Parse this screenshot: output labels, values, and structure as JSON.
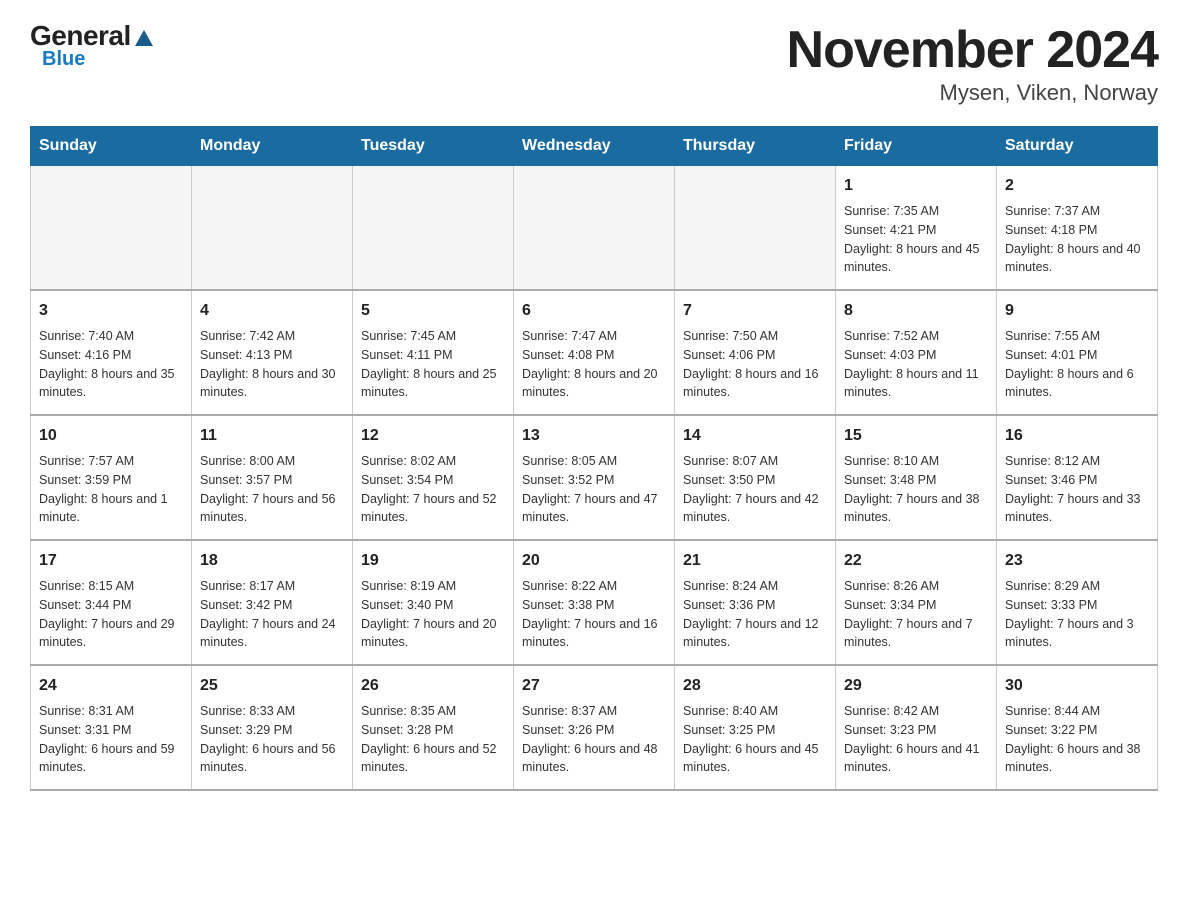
{
  "header": {
    "logo_general": "General",
    "logo_blue": "Blue",
    "title": "November 2024",
    "subtitle": "Mysen, Viken, Norway"
  },
  "weekdays": [
    "Sunday",
    "Monday",
    "Tuesday",
    "Wednesday",
    "Thursday",
    "Friday",
    "Saturday"
  ],
  "rows": [
    [
      {
        "day": "",
        "info": ""
      },
      {
        "day": "",
        "info": ""
      },
      {
        "day": "",
        "info": ""
      },
      {
        "day": "",
        "info": ""
      },
      {
        "day": "",
        "info": ""
      },
      {
        "day": "1",
        "info": "Sunrise: 7:35 AM\nSunset: 4:21 PM\nDaylight: 8 hours and 45 minutes."
      },
      {
        "day": "2",
        "info": "Sunrise: 7:37 AM\nSunset: 4:18 PM\nDaylight: 8 hours and 40 minutes."
      }
    ],
    [
      {
        "day": "3",
        "info": "Sunrise: 7:40 AM\nSunset: 4:16 PM\nDaylight: 8 hours and 35 minutes."
      },
      {
        "day": "4",
        "info": "Sunrise: 7:42 AM\nSunset: 4:13 PM\nDaylight: 8 hours and 30 minutes."
      },
      {
        "day": "5",
        "info": "Sunrise: 7:45 AM\nSunset: 4:11 PM\nDaylight: 8 hours and 25 minutes."
      },
      {
        "day": "6",
        "info": "Sunrise: 7:47 AM\nSunset: 4:08 PM\nDaylight: 8 hours and 20 minutes."
      },
      {
        "day": "7",
        "info": "Sunrise: 7:50 AM\nSunset: 4:06 PM\nDaylight: 8 hours and 16 minutes."
      },
      {
        "day": "8",
        "info": "Sunrise: 7:52 AM\nSunset: 4:03 PM\nDaylight: 8 hours and 11 minutes."
      },
      {
        "day": "9",
        "info": "Sunrise: 7:55 AM\nSunset: 4:01 PM\nDaylight: 8 hours and 6 minutes."
      }
    ],
    [
      {
        "day": "10",
        "info": "Sunrise: 7:57 AM\nSunset: 3:59 PM\nDaylight: 8 hours and 1 minute."
      },
      {
        "day": "11",
        "info": "Sunrise: 8:00 AM\nSunset: 3:57 PM\nDaylight: 7 hours and 56 minutes."
      },
      {
        "day": "12",
        "info": "Sunrise: 8:02 AM\nSunset: 3:54 PM\nDaylight: 7 hours and 52 minutes."
      },
      {
        "day": "13",
        "info": "Sunrise: 8:05 AM\nSunset: 3:52 PM\nDaylight: 7 hours and 47 minutes."
      },
      {
        "day": "14",
        "info": "Sunrise: 8:07 AM\nSunset: 3:50 PM\nDaylight: 7 hours and 42 minutes."
      },
      {
        "day": "15",
        "info": "Sunrise: 8:10 AM\nSunset: 3:48 PM\nDaylight: 7 hours and 38 minutes."
      },
      {
        "day": "16",
        "info": "Sunrise: 8:12 AM\nSunset: 3:46 PM\nDaylight: 7 hours and 33 minutes."
      }
    ],
    [
      {
        "day": "17",
        "info": "Sunrise: 8:15 AM\nSunset: 3:44 PM\nDaylight: 7 hours and 29 minutes."
      },
      {
        "day": "18",
        "info": "Sunrise: 8:17 AM\nSunset: 3:42 PM\nDaylight: 7 hours and 24 minutes."
      },
      {
        "day": "19",
        "info": "Sunrise: 8:19 AM\nSunset: 3:40 PM\nDaylight: 7 hours and 20 minutes."
      },
      {
        "day": "20",
        "info": "Sunrise: 8:22 AM\nSunset: 3:38 PM\nDaylight: 7 hours and 16 minutes."
      },
      {
        "day": "21",
        "info": "Sunrise: 8:24 AM\nSunset: 3:36 PM\nDaylight: 7 hours and 12 minutes."
      },
      {
        "day": "22",
        "info": "Sunrise: 8:26 AM\nSunset: 3:34 PM\nDaylight: 7 hours and 7 minutes."
      },
      {
        "day": "23",
        "info": "Sunrise: 8:29 AM\nSunset: 3:33 PM\nDaylight: 7 hours and 3 minutes."
      }
    ],
    [
      {
        "day": "24",
        "info": "Sunrise: 8:31 AM\nSunset: 3:31 PM\nDaylight: 6 hours and 59 minutes."
      },
      {
        "day": "25",
        "info": "Sunrise: 8:33 AM\nSunset: 3:29 PM\nDaylight: 6 hours and 56 minutes."
      },
      {
        "day": "26",
        "info": "Sunrise: 8:35 AM\nSunset: 3:28 PM\nDaylight: 6 hours and 52 minutes."
      },
      {
        "day": "27",
        "info": "Sunrise: 8:37 AM\nSunset: 3:26 PM\nDaylight: 6 hours and 48 minutes."
      },
      {
        "day": "28",
        "info": "Sunrise: 8:40 AM\nSunset: 3:25 PM\nDaylight: 6 hours and 45 minutes."
      },
      {
        "day": "29",
        "info": "Sunrise: 8:42 AM\nSunset: 3:23 PM\nDaylight: 6 hours and 41 minutes."
      },
      {
        "day": "30",
        "info": "Sunrise: 8:44 AM\nSunset: 3:22 PM\nDaylight: 6 hours and 38 minutes."
      }
    ]
  ]
}
